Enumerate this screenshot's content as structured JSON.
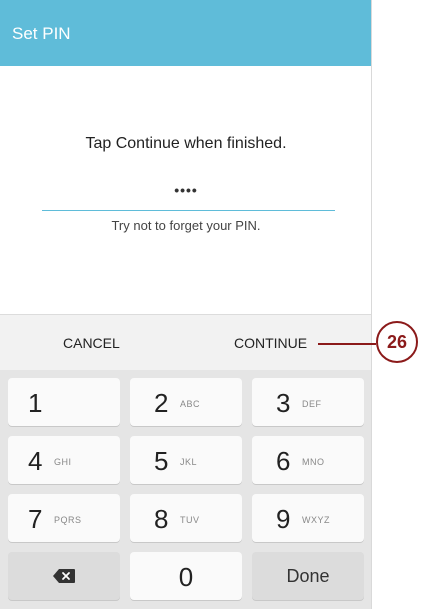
{
  "header": {
    "title": "Set PIN"
  },
  "content": {
    "instruction": "Tap Continue when finished.",
    "pin_value": "••••",
    "hint": "Try not to forget your PIN."
  },
  "actions": {
    "cancel": "CANCEL",
    "continue": "CONTINUE"
  },
  "keypad": {
    "keys": [
      {
        "digit": "1",
        "letters": ""
      },
      {
        "digit": "2",
        "letters": "ABC"
      },
      {
        "digit": "3",
        "letters": "DEF"
      },
      {
        "digit": "4",
        "letters": "GHI"
      },
      {
        "digit": "5",
        "letters": "JKL"
      },
      {
        "digit": "6",
        "letters": "MNO"
      },
      {
        "digit": "7",
        "letters": "PQRS"
      },
      {
        "digit": "8",
        "letters": "TUV"
      },
      {
        "digit": "9",
        "letters": "WXYZ"
      }
    ],
    "zero": "0",
    "done": "Done",
    "backspace_icon": "backspace-icon"
  },
  "callout": {
    "number": "26",
    "color": "#8b1a1a"
  },
  "colors": {
    "header": "#5fbcd9",
    "accent_line": "#5fbcd9"
  }
}
